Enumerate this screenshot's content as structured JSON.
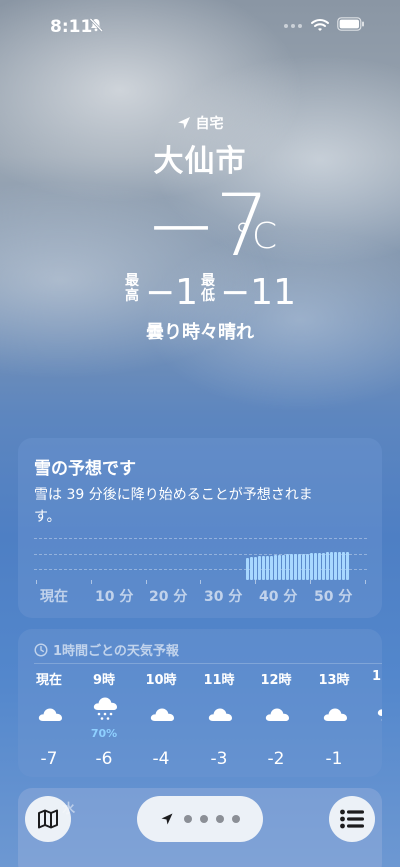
{
  "status_bar": {
    "time": "8:11"
  },
  "location": {
    "label": "自宅",
    "city": "大仙市",
    "temperature": "−7",
    "unit": "°C",
    "high_label": "最高",
    "high_value": "−1",
    "low_label": "最低",
    "low_value": "−11",
    "condition": "曇り時々晴れ"
  },
  "snow_card": {
    "title": "雪の予想です",
    "description": "雪は 39 分後に降り始めることが予想されます。",
    "axis_labels": [
      "現在",
      "10 分",
      "20 分",
      "30 分",
      "40 分",
      "50 分"
    ]
  },
  "hourly": {
    "title": "1時間ごとの天気予報",
    "hours": [
      {
        "label": "現在",
        "icon": "cloud-icon",
        "prob": "",
        "temp": "-7"
      },
      {
        "label": "9時",
        "icon": "cloud-snow-icon",
        "prob": "70%",
        "temp": "-6"
      },
      {
        "label": "10時",
        "icon": "cloud-icon",
        "prob": "",
        "temp": "-4"
      },
      {
        "label": "11時",
        "icon": "cloud-icon",
        "prob": "",
        "temp": "-3"
      },
      {
        "label": "12時",
        "icon": "cloud-icon",
        "prob": "",
        "temp": "-2"
      },
      {
        "label": "13時",
        "icon": "cloud-icon",
        "prob": "",
        "temp": "-1"
      },
      {
        "label": "1",
        "icon": "cloud-snow-icon",
        "prob": "",
        "temp": ""
      }
    ]
  },
  "bottom_card": {
    "label": "水"
  },
  "colors": {
    "precip_bar": "#a8d8ff",
    "precip_prob": "#8fd0ff"
  },
  "snow_intensity": [
    0.7,
    0.72,
    0.72,
    0.74,
    0.74,
    0.76,
    0.76,
    0.78,
    0.78,
    0.78,
    0.8,
    0.8,
    0.8,
    0.82,
    0.82,
    0.82,
    0.84,
    0.84,
    0.84,
    0.84,
    0.86,
    0.86,
    0.86,
    0.88,
    0.88,
    0.88
  ]
}
